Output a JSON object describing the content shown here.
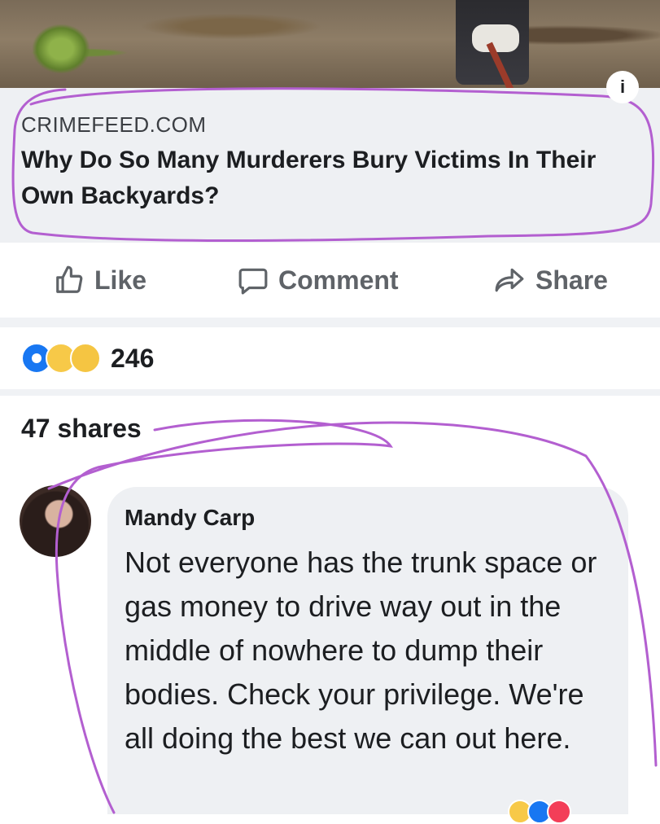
{
  "link_preview": {
    "domain": "CRIMEFEED.COM",
    "title": "Why Do So Many Murderers Bury Victims In Their Own Backyards?",
    "info_icon": "info-icon"
  },
  "actions": {
    "like_label": "Like",
    "comment_label": "Comment",
    "share_label": "Share"
  },
  "reactions": {
    "icons": [
      "like-reaction-icon",
      "wow-reaction-icon",
      "haha-reaction-icon"
    ],
    "count": "246"
  },
  "shares": {
    "label": "47 shares"
  },
  "comment": {
    "author": "Mandy Carp",
    "text": "Not everyone has the trunk space or gas money to drive way out in the middle of nowhere to dump their bodies. Check your privilege. We're all doing the best we can out here."
  },
  "colors": {
    "annotation": "#b35fd0",
    "accent": "#1877f2",
    "caption_bg": "#eef0f3"
  }
}
